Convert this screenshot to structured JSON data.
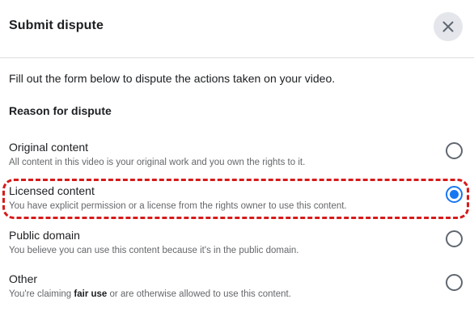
{
  "dialog": {
    "title": "Submit dispute",
    "close_icon": "close-icon",
    "intro": "Fill out the form below to dispute the actions taken on your video.",
    "section_heading": "Reason for dispute"
  },
  "options": [
    {
      "label": "Original content",
      "description": "All content in this video is your original work and you own the rights to it.",
      "selected": false
    },
    {
      "label": "Licensed content",
      "description": "You have explicit permission or a license from the rights owner to use this content.",
      "selected": true
    },
    {
      "label": "Public domain",
      "description": "You believe you can use this content because it's in the public domain.",
      "selected": false
    },
    {
      "label": "Other",
      "description_prefix": "You're claiming ",
      "description_bold": "fair use",
      "description_suffix": " or are otherwise allowed to use this content.",
      "selected": false
    }
  ],
  "colors": {
    "accent": "#1877f2",
    "highlight": "#d61a1a",
    "secondary_text": "#65676b"
  }
}
